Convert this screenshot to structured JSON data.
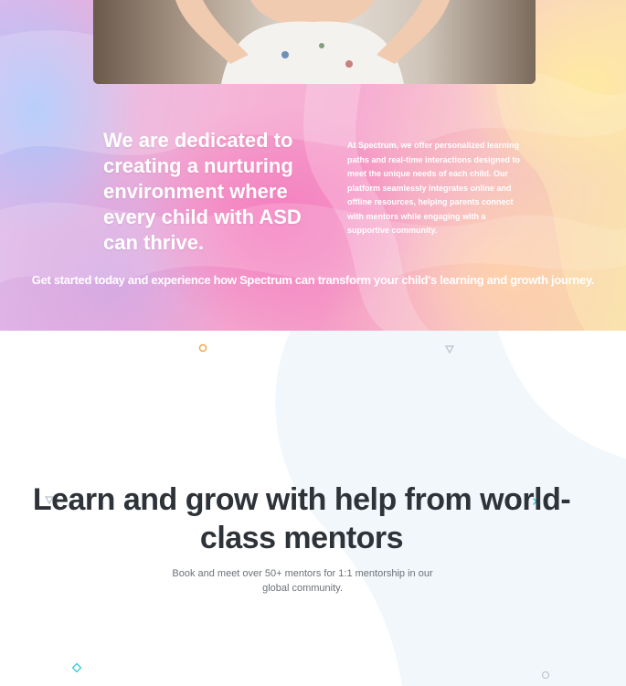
{
  "hero": {
    "heading": "We are dedicated to creating a nurturing environment where every child with ASD can thrive.",
    "paragraph": "At Spectrum, we offer personalized learning paths and real-time interactions designed to meet the unique needs of each child. Our platform seamlessly integrates online and offline resources, helping parents connect with mentors while engaging with a supportive community.",
    "cta": "Get started today and experience how Spectrum can transform your child's learning and growth journey."
  },
  "mentors": {
    "title": "Learn and grow with help from world-class mentors",
    "subtitle": "Book and meet over 50+ mentors for 1:1 mentorship in our global community."
  },
  "colors": {
    "heading_text": "#2e3339",
    "body_text": "#6b7178",
    "blob": "#f2f7fb",
    "deco_orange": "#f2a444",
    "deco_teal": "#38c7d6",
    "deco_gray": "#b9c0c7"
  }
}
